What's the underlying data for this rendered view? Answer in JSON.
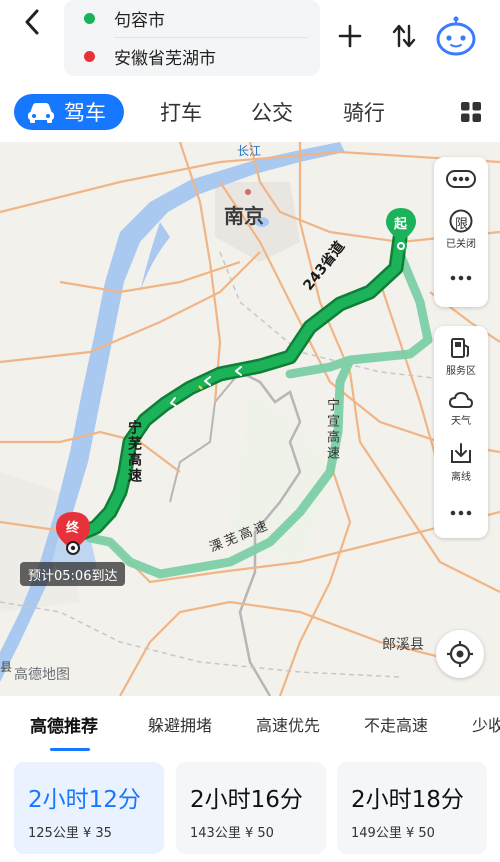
{
  "header": {
    "origin": "句容市",
    "destination": "安徽省芜湖市"
  },
  "mode_tabs": [
    {
      "label": "驾车"
    },
    {
      "label": "打车"
    },
    {
      "label": "公交"
    },
    {
      "label": "骑行"
    }
  ],
  "map": {
    "labels": {
      "changjiang": "长江",
      "nanjing": "南京",
      "langxi": "郎溪县",
      "logo": "高德地图",
      "edge_left": "县"
    },
    "markers": {
      "start": "起",
      "end": "终"
    },
    "eta": "预计05:06到达",
    "road_labels": {
      "provincial": "243省道",
      "ningwu": "宁芜高速",
      "ningxuan": "宁宣高速",
      "liwu": "溧芜高速"
    },
    "side_panel": {
      "limit_badge": "限",
      "limit_status": "已关闭",
      "service_area": "服务区",
      "weather": "天气",
      "offline": "离线"
    }
  },
  "route_prefs": [
    {
      "label": "高德推荐"
    },
    {
      "label": "躲避拥堵"
    },
    {
      "label": "高速优先"
    },
    {
      "label": "不走高速"
    },
    {
      "label": "少收费"
    }
  ],
  "plans": [
    {
      "time": "2小时12分",
      "meta": "125公里  ¥ 35"
    },
    {
      "time": "2小时16分",
      "meta": "143公里  ¥ 50"
    },
    {
      "time": "2小时18分",
      "meta": "149公里  ¥ 50"
    }
  ],
  "colors": {
    "accent": "#1677ff",
    "route_main": "#17a24b",
    "route_alt": "#7ccfa6",
    "start_marker": "#1bb25a",
    "end_marker": "#e8323b"
  }
}
